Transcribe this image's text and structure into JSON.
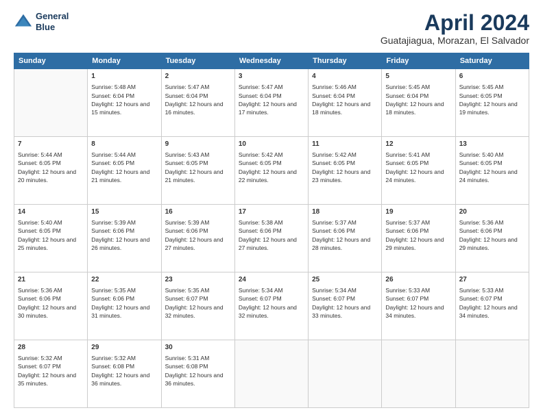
{
  "header": {
    "logo_line1": "General",
    "logo_line2": "Blue",
    "month": "April 2024",
    "location": "Guatajiagua, Morazan, El Salvador"
  },
  "weekdays": [
    "Sunday",
    "Monday",
    "Tuesday",
    "Wednesday",
    "Thursday",
    "Friday",
    "Saturday"
  ],
  "weeks": [
    [
      {
        "day": null,
        "sunrise": null,
        "sunset": null,
        "daylight": null
      },
      {
        "day": "1",
        "sunrise": "Sunrise: 5:48 AM",
        "sunset": "Sunset: 6:04 PM",
        "daylight": "Daylight: 12 hours and 15 minutes."
      },
      {
        "day": "2",
        "sunrise": "Sunrise: 5:47 AM",
        "sunset": "Sunset: 6:04 PM",
        "daylight": "Daylight: 12 hours and 16 minutes."
      },
      {
        "day": "3",
        "sunrise": "Sunrise: 5:47 AM",
        "sunset": "Sunset: 6:04 PM",
        "daylight": "Daylight: 12 hours and 17 minutes."
      },
      {
        "day": "4",
        "sunrise": "Sunrise: 5:46 AM",
        "sunset": "Sunset: 6:04 PM",
        "daylight": "Daylight: 12 hours and 18 minutes."
      },
      {
        "day": "5",
        "sunrise": "Sunrise: 5:45 AM",
        "sunset": "Sunset: 6:04 PM",
        "daylight": "Daylight: 12 hours and 18 minutes."
      },
      {
        "day": "6",
        "sunrise": "Sunrise: 5:45 AM",
        "sunset": "Sunset: 6:05 PM",
        "daylight": "Daylight: 12 hours and 19 minutes."
      }
    ],
    [
      {
        "day": "7",
        "sunrise": "Sunrise: 5:44 AM",
        "sunset": "Sunset: 6:05 PM",
        "daylight": "Daylight: 12 hours and 20 minutes."
      },
      {
        "day": "8",
        "sunrise": "Sunrise: 5:44 AM",
        "sunset": "Sunset: 6:05 PM",
        "daylight": "Daylight: 12 hours and 21 minutes."
      },
      {
        "day": "9",
        "sunrise": "Sunrise: 5:43 AM",
        "sunset": "Sunset: 6:05 PM",
        "daylight": "Daylight: 12 hours and 21 minutes."
      },
      {
        "day": "10",
        "sunrise": "Sunrise: 5:42 AM",
        "sunset": "Sunset: 6:05 PM",
        "daylight": "Daylight: 12 hours and 22 minutes."
      },
      {
        "day": "11",
        "sunrise": "Sunrise: 5:42 AM",
        "sunset": "Sunset: 6:05 PM",
        "daylight": "Daylight: 12 hours and 23 minutes."
      },
      {
        "day": "12",
        "sunrise": "Sunrise: 5:41 AM",
        "sunset": "Sunset: 6:05 PM",
        "daylight": "Daylight: 12 hours and 24 minutes."
      },
      {
        "day": "13",
        "sunrise": "Sunrise: 5:40 AM",
        "sunset": "Sunset: 6:05 PM",
        "daylight": "Daylight: 12 hours and 24 minutes."
      }
    ],
    [
      {
        "day": "14",
        "sunrise": "Sunrise: 5:40 AM",
        "sunset": "Sunset: 6:05 PM",
        "daylight": "Daylight: 12 hours and 25 minutes."
      },
      {
        "day": "15",
        "sunrise": "Sunrise: 5:39 AM",
        "sunset": "Sunset: 6:06 PM",
        "daylight": "Daylight: 12 hours and 26 minutes."
      },
      {
        "day": "16",
        "sunrise": "Sunrise: 5:39 AM",
        "sunset": "Sunset: 6:06 PM",
        "daylight": "Daylight: 12 hours and 27 minutes."
      },
      {
        "day": "17",
        "sunrise": "Sunrise: 5:38 AM",
        "sunset": "Sunset: 6:06 PM",
        "daylight": "Daylight: 12 hours and 27 minutes."
      },
      {
        "day": "18",
        "sunrise": "Sunrise: 5:37 AM",
        "sunset": "Sunset: 6:06 PM",
        "daylight": "Daylight: 12 hours and 28 minutes."
      },
      {
        "day": "19",
        "sunrise": "Sunrise: 5:37 AM",
        "sunset": "Sunset: 6:06 PM",
        "daylight": "Daylight: 12 hours and 29 minutes."
      },
      {
        "day": "20",
        "sunrise": "Sunrise: 5:36 AM",
        "sunset": "Sunset: 6:06 PM",
        "daylight": "Daylight: 12 hours and 29 minutes."
      }
    ],
    [
      {
        "day": "21",
        "sunrise": "Sunrise: 5:36 AM",
        "sunset": "Sunset: 6:06 PM",
        "daylight": "Daylight: 12 hours and 30 minutes."
      },
      {
        "day": "22",
        "sunrise": "Sunrise: 5:35 AM",
        "sunset": "Sunset: 6:06 PM",
        "daylight": "Daylight: 12 hours and 31 minutes."
      },
      {
        "day": "23",
        "sunrise": "Sunrise: 5:35 AM",
        "sunset": "Sunset: 6:07 PM",
        "daylight": "Daylight: 12 hours and 32 minutes."
      },
      {
        "day": "24",
        "sunrise": "Sunrise: 5:34 AM",
        "sunset": "Sunset: 6:07 PM",
        "daylight": "Daylight: 12 hours and 32 minutes."
      },
      {
        "day": "25",
        "sunrise": "Sunrise: 5:34 AM",
        "sunset": "Sunset: 6:07 PM",
        "daylight": "Daylight: 12 hours and 33 minutes."
      },
      {
        "day": "26",
        "sunrise": "Sunrise: 5:33 AM",
        "sunset": "Sunset: 6:07 PM",
        "daylight": "Daylight: 12 hours and 34 minutes."
      },
      {
        "day": "27",
        "sunrise": "Sunrise: 5:33 AM",
        "sunset": "Sunset: 6:07 PM",
        "daylight": "Daylight: 12 hours and 34 minutes."
      }
    ],
    [
      {
        "day": "28",
        "sunrise": "Sunrise: 5:32 AM",
        "sunset": "Sunset: 6:07 PM",
        "daylight": "Daylight: 12 hours and 35 minutes."
      },
      {
        "day": "29",
        "sunrise": "Sunrise: 5:32 AM",
        "sunset": "Sunset: 6:08 PM",
        "daylight": "Daylight: 12 hours and 36 minutes."
      },
      {
        "day": "30",
        "sunrise": "Sunrise: 5:31 AM",
        "sunset": "Sunset: 6:08 PM",
        "daylight": "Daylight: 12 hours and 36 minutes."
      },
      {
        "day": null,
        "sunrise": null,
        "sunset": null,
        "daylight": null
      },
      {
        "day": null,
        "sunrise": null,
        "sunset": null,
        "daylight": null
      },
      {
        "day": null,
        "sunrise": null,
        "sunset": null,
        "daylight": null
      },
      {
        "day": null,
        "sunrise": null,
        "sunset": null,
        "daylight": null
      }
    ]
  ]
}
